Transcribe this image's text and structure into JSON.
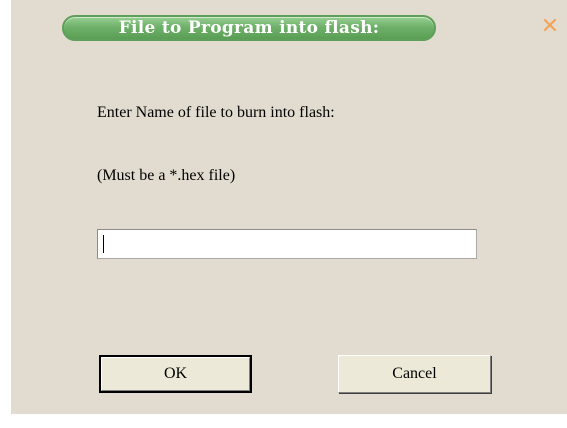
{
  "dialog": {
    "title": "File to Program into flash:",
    "close_icon": "close-icon",
    "close_glyph": "✕"
  },
  "form": {
    "instruction": "Enter Name of file to burn into flash:",
    "hint": "(Must be a *.hex file)",
    "filename_value": "",
    "filename_placeholder": ""
  },
  "buttons": {
    "ok_label": "OK",
    "cancel_label": "Cancel"
  },
  "colors": {
    "dialog_background": "#e1dccf",
    "title_pill_green": "#6fb16a",
    "close_orange": "#f2a45b"
  }
}
